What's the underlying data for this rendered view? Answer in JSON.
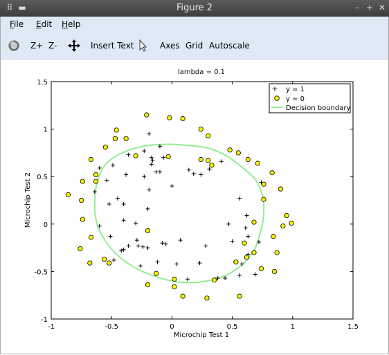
{
  "window": {
    "title": "Figure 2",
    "controls": [
      "–",
      "+",
      "✕"
    ]
  },
  "menu": {
    "items": [
      {
        "label": "File",
        "u": "F",
        "rest": "ile"
      },
      {
        "label": "Edit",
        "u": "E",
        "rest": "dit"
      },
      {
        "label": "Help",
        "u": "H",
        "rest": "elp"
      }
    ]
  },
  "toolbar": {
    "zoom_in": "Z+",
    "zoom_out": "Z-",
    "insert_text": "Insert Text",
    "axes": "Axes",
    "grid": "Grid",
    "autoscale": "Autoscale"
  },
  "chart_data": {
    "type": "scatter",
    "title": "lambda = 0.1",
    "xlabel": "Microchip Test 1",
    "ylabel": "Microchip Test 2",
    "xlim": [
      -1,
      1.5
    ],
    "ylim": [
      -1,
      1.5
    ],
    "xticks": [
      -1,
      -0.5,
      0,
      0.5,
      1,
      1.5
    ],
    "yticks": [
      -1,
      -0.5,
      0,
      0.5,
      1,
      1.5
    ],
    "xtick_labels": [
      "-1",
      "-0.5",
      "0",
      "0.5",
      "1",
      "1.5"
    ],
    "ytick_labels": [
      "-1",
      "-0.5",
      "0",
      "0.5",
      "1",
      "1.5"
    ],
    "legend_position": "top-right",
    "series": [
      {
        "name": "y = 1",
        "marker": "plus",
        "color": "#000000",
        "points": [
          [
            -0.19,
            0.95
          ],
          [
            -0.1,
            0.82
          ],
          [
            -0.23,
            0.77
          ],
          [
            -0.36,
            0.73
          ],
          [
            -0.6,
            0.59
          ],
          [
            -0.49,
            0.62
          ],
          [
            -0.17,
            0.7
          ],
          [
            -0.16,
            0.67
          ],
          [
            -0.17,
            0.63
          ],
          [
            -0.13,
            0.55
          ],
          [
            -0.1,
            0.55
          ],
          [
            0.14,
            0.57
          ],
          [
            0.18,
            0.53
          ],
          [
            0.24,
            0.52
          ],
          [
            0.31,
            0.58
          ],
          [
            0.41,
            0.66
          ],
          [
            -0.23,
            0.5
          ],
          [
            -0.38,
            0.52
          ],
          [
            -0.07,
            0.7
          ],
          [
            -0.19,
            0.36
          ],
          [
            0.0,
            0.4
          ],
          [
            -0.54,
            0.46
          ],
          [
            -0.64,
            0.34
          ],
          [
            -0.45,
            0.27
          ],
          [
            -0.4,
            0.21
          ],
          [
            -0.52,
            0.21
          ],
          [
            -0.2,
            0.16
          ],
          [
            -0.4,
            0.04
          ],
          [
            -0.3,
            0.01
          ],
          [
            -0.6,
            -0.02
          ],
          [
            -0.51,
            -0.13
          ],
          [
            -0.29,
            -0.17
          ],
          [
            -0.36,
            -0.23
          ],
          [
            -0.28,
            -0.23
          ],
          [
            -0.24,
            -0.24
          ],
          [
            -0.2,
            -0.25
          ],
          [
            -0.4,
            -0.27
          ],
          [
            -0.42,
            -0.28
          ],
          [
            -0.08,
            -0.2
          ],
          [
            0.07,
            -0.17
          ],
          [
            0.28,
            -0.23
          ],
          [
            0.5,
            -0.18
          ],
          [
            0.47,
            0.0
          ],
          [
            0.56,
            0.27
          ],
          [
            0.62,
            0.09
          ],
          [
            0.74,
            0.44
          ],
          [
            0.61,
            -0.04
          ],
          [
            0.63,
            -0.13
          ],
          [
            0.72,
            -0.19
          ],
          [
            0.63,
            -0.32
          ],
          [
            0.69,
            -0.53
          ],
          [
            0.58,
            -0.42
          ],
          [
            0.56,
            -0.54
          ],
          [
            0.44,
            -0.57
          ],
          [
            0.38,
            -0.57
          ],
          [
            0.23,
            -0.41
          ],
          [
            0.13,
            -0.58
          ],
          [
            0.04,
            -0.42
          ],
          [
            -0.12,
            -0.4
          ],
          [
            -0.05,
            -0.21
          ],
          [
            -0.26,
            -0.44
          ],
          [
            -0.48,
            -0.38
          ]
        ]
      },
      {
        "name": "y = 0",
        "marker": "circle",
        "color": "#f5f100",
        "points": [
          [
            -0.21,
            1.15
          ],
          [
            0.24,
            1.0
          ],
          [
            -0.46,
            0.99
          ],
          [
            0.09,
            1.11
          ],
          [
            -0.02,
            1.12
          ],
          [
            -0.47,
            0.9
          ],
          [
            -0.38,
            0.9
          ],
          [
            0.3,
            0.93
          ],
          [
            0.33,
            0.62
          ],
          [
            -0.03,
            0.71
          ],
          [
            0.3,
            0.67
          ],
          [
            0.48,
            0.78
          ],
          [
            0.55,
            0.75
          ],
          [
            0.63,
            0.68
          ],
          [
            0.71,
            0.64
          ],
          [
            0.83,
            0.54
          ],
          [
            0.9,
            0.37
          ],
          [
            0.76,
            0.26
          ],
          [
            0.95,
            0.09
          ],
          [
            0.99,
            0.01
          ],
          [
            0.92,
            -0.02
          ],
          [
            0.84,
            -0.13
          ],
          [
            0.87,
            -0.3
          ],
          [
            0.74,
            -0.47
          ],
          [
            0.85,
            -0.5
          ],
          [
            0.56,
            -0.76
          ],
          [
            0.35,
            -0.59
          ],
          [
            0.29,
            -0.78
          ],
          [
            0.09,
            -0.76
          ],
          [
            0.02,
            -0.66
          ],
          [
            -0.2,
            -0.64
          ],
          [
            0.02,
            -0.58
          ],
          [
            -0.13,
            -0.52
          ],
          [
            0.53,
            -0.4
          ],
          [
            0.62,
            -0.35
          ],
          [
            0.68,
            -0.3
          ],
          [
            0.6,
            -0.2
          ],
          [
            0.68,
            0.02
          ],
          [
            0.76,
            0.42
          ],
          [
            -0.55,
            0.81
          ],
          [
            -0.67,
            0.68
          ],
          [
            -0.63,
            0.52
          ],
          [
            -0.74,
            0.45
          ],
          [
            -0.86,
            0.31
          ],
          [
            -0.74,
            0.05
          ],
          [
            -0.67,
            -0.14
          ],
          [
            -0.76,
            -0.26
          ],
          [
            -0.68,
            -0.41
          ],
          [
            -0.52,
            -0.41
          ],
          [
            -0.56,
            -0.37
          ],
          [
            -0.2,
            -0.07
          ],
          [
            0.24,
            0.68
          ],
          [
            -0.3,
            0.72
          ],
          [
            -0.75,
            0.25
          ],
          [
            -0.63,
            0.45
          ]
        ]
      }
    ],
    "decision_boundary": {
      "name": "Decision boundary",
      "color": "#90ee90",
      "points": [
        [
          -0.62,
          0.44
        ],
        [
          -0.55,
          0.63
        ],
        [
          -0.41,
          0.75
        ],
        [
          -0.24,
          0.82
        ],
        [
          -0.06,
          0.84
        ],
        [
          0.12,
          0.83
        ],
        [
          0.3,
          0.8
        ],
        [
          0.45,
          0.72
        ],
        [
          0.58,
          0.6
        ],
        [
          0.69,
          0.47
        ],
        [
          0.75,
          0.3
        ],
        [
          0.76,
          0.1
        ],
        [
          0.73,
          -0.1
        ],
        [
          0.67,
          -0.3
        ],
        [
          0.56,
          -0.45
        ],
        [
          0.41,
          -0.56
        ],
        [
          0.23,
          -0.61
        ],
        [
          0.05,
          -0.61
        ],
        [
          -0.12,
          -0.56
        ],
        [
          -0.29,
          -0.47
        ],
        [
          -0.44,
          -0.34
        ],
        [
          -0.55,
          -0.18
        ],
        [
          -0.62,
          0.0
        ],
        [
          -0.64,
          0.2
        ],
        [
          -0.62,
          0.44
        ]
      ]
    }
  }
}
